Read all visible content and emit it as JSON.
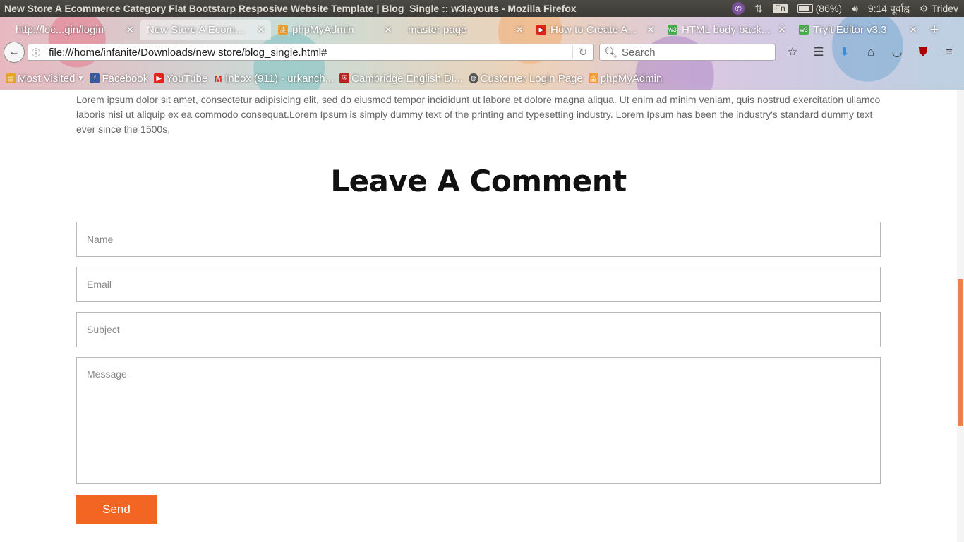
{
  "window": {
    "title": "New Store A Ecommerce Category Flat Bootstarp Resposive Website Template | Blog_Single :: w3layouts - Mozilla Firefox",
    "tray": {
      "keyboard_lang": "En",
      "battery": "(86%)",
      "clock": "9:14 पूर्वाह्न",
      "user": "Tridev"
    }
  },
  "tabs": [
    {
      "label": "http://loc...gin/login",
      "icon": "page-icon"
    },
    {
      "label": "New Store A Ecom...",
      "icon": "page-icon",
      "active": true
    },
    {
      "label": "phpMyAdmin",
      "icon": "phpmyadmin-icon"
    },
    {
      "label": "master page",
      "icon": "page-icon"
    },
    {
      "label": "How to Create A...",
      "icon": "youtube-icon"
    },
    {
      "label": "HTML body back...",
      "icon": "w3schools-icon"
    },
    {
      "label": "Tryit Editor v3.3",
      "icon": "w3schools-icon"
    }
  ],
  "navbar": {
    "url": "file:///home/infanite/Downloads/new store/blog_single.html#",
    "search_placeholder": "Search"
  },
  "bookmarks": [
    {
      "label": "Most Visited",
      "icon": "folder-icon"
    },
    {
      "label": "Facebook",
      "icon": "facebook-icon"
    },
    {
      "label": "YouTube",
      "icon": "youtube-icon"
    },
    {
      "label": "Inbox (911) - urkanch...",
      "icon": "gmail-icon"
    },
    {
      "label": "Cambridge English Di...",
      "icon": "cambridge-icon"
    },
    {
      "label": "Customer Login Page",
      "icon": "globe-icon"
    },
    {
      "label": "phpMyAdmin",
      "icon": "phpmyadmin-icon"
    }
  ],
  "content": {
    "paragraph": "Lorem ipsum dolor sit amet, consectetur adipisicing elit, sed do eiusmod tempor incididunt ut labore et dolore magna aliqua. Ut enim ad minim veniam, quis nostrud exercitation ullamco laboris nisi ut aliquip ex ea commodo consequat.Lorem Ipsum is simply dummy text of the printing and typesetting industry. Lorem Ipsum has been the industry's standard dummy text ever since the 1500s,",
    "comment_title": "Leave A Comment",
    "form": {
      "name_placeholder": "Name",
      "email_placeholder": "Email",
      "subject_placeholder": "Subject",
      "message_placeholder": "Message",
      "send_label": "Send"
    }
  },
  "colors": {
    "accent": "#f26522",
    "scrollbar_thumb": "#f07f4c"
  }
}
